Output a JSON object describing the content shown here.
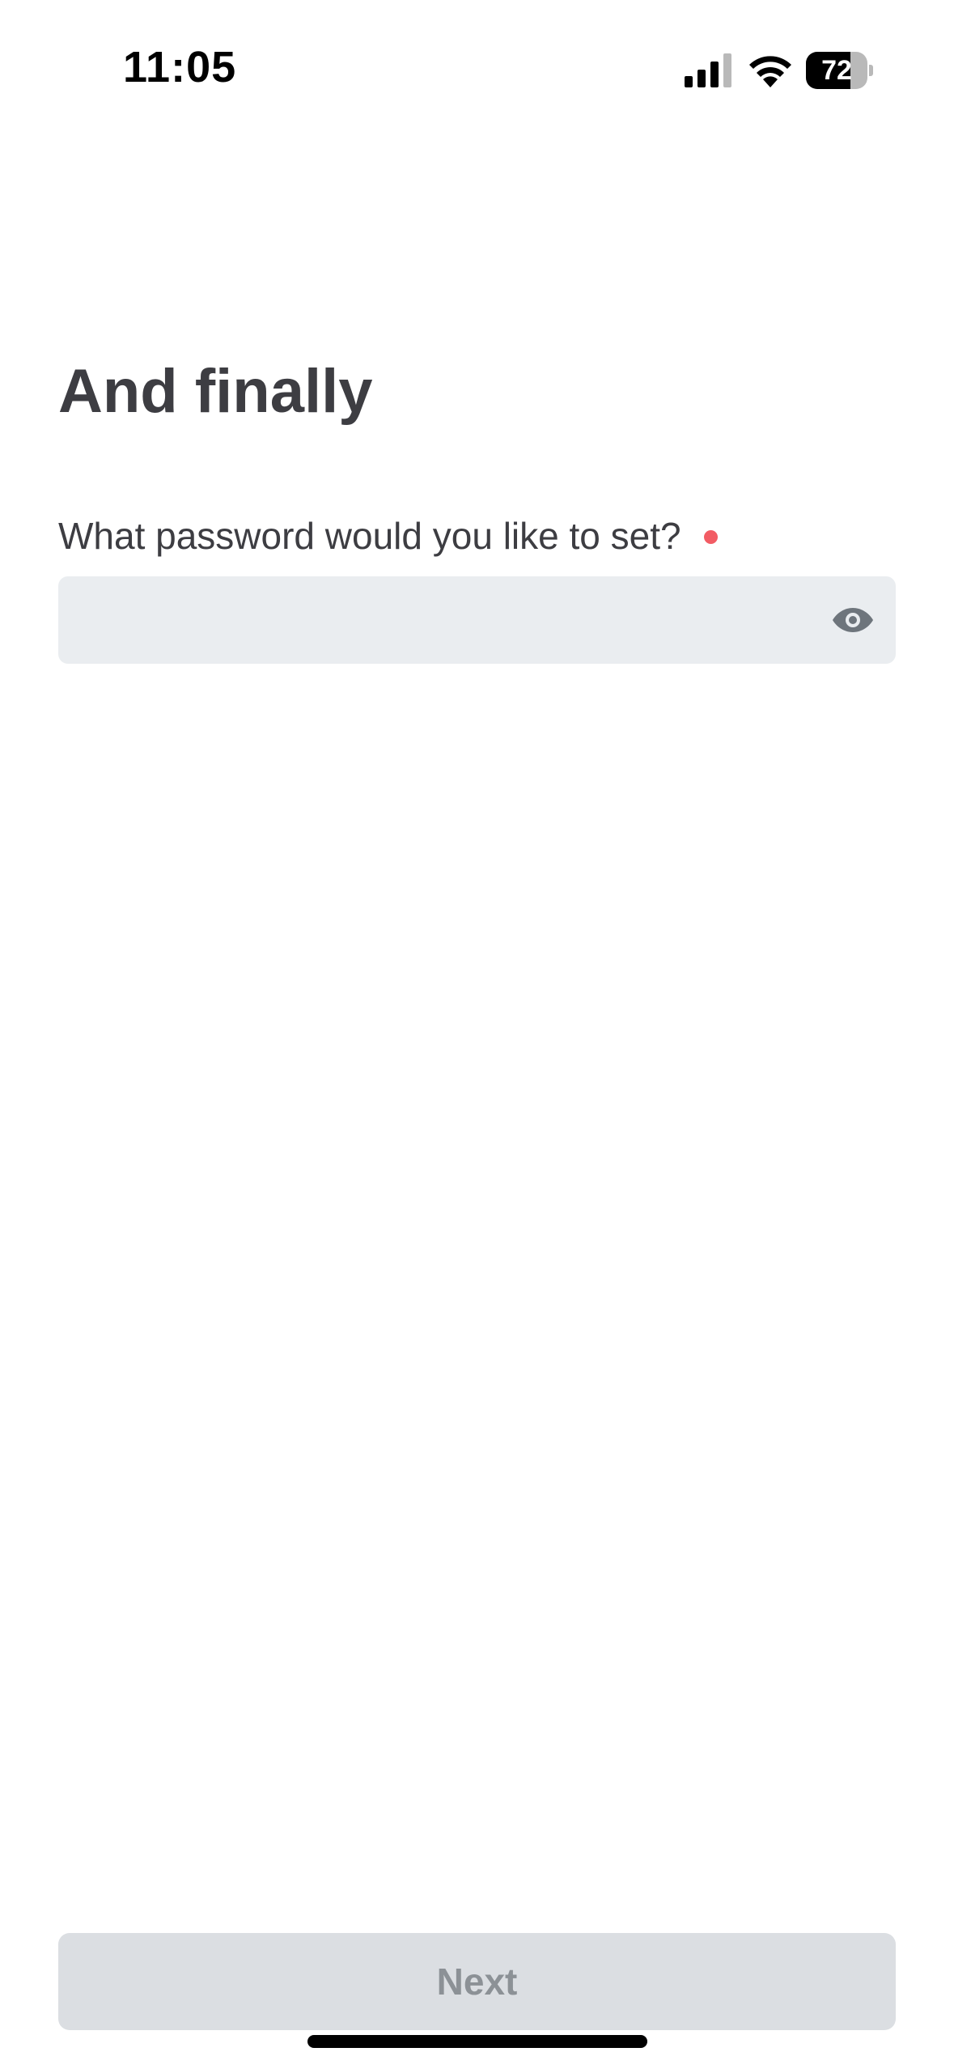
{
  "status_bar": {
    "time": "11:05",
    "battery_level": "72",
    "battery_fraction": 0.72,
    "signal_bars_active": 3,
    "signal_bars_total": 4,
    "icons": [
      "cellular-signal-icon",
      "wifi-icon",
      "battery-icon"
    ]
  },
  "page": {
    "title": "And finally"
  },
  "password_field": {
    "label": "What password would you like to set?",
    "value": "",
    "placeholder": "",
    "required": true,
    "required_color": "#f25c64",
    "toggle_icon": "eye-icon"
  },
  "footer": {
    "next_label": "Next",
    "next_enabled": false
  },
  "colors": {
    "text": "#3d3d42",
    "field_background": "#eaedf0",
    "button_disabled_background": "#dbdee2",
    "button_disabled_text": "#8c9196",
    "icon": "#6e757c"
  }
}
